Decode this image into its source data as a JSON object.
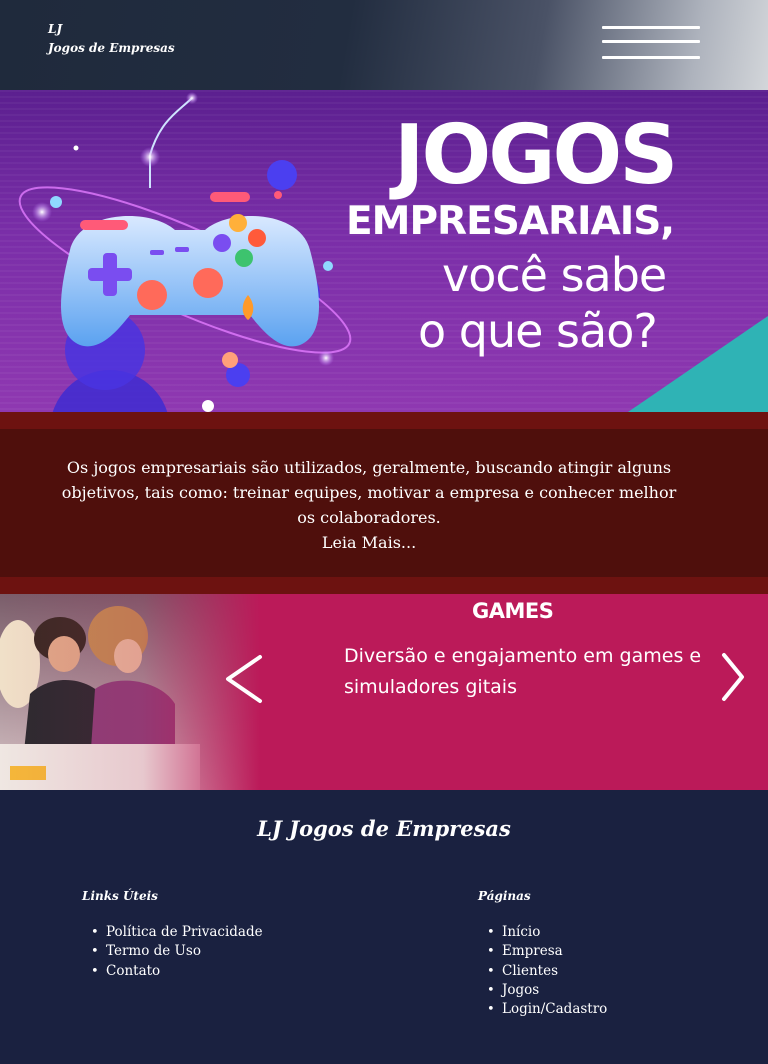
{
  "header": {
    "brand_line1": "LJ",
    "brand_line2": "Jogos de Empresas",
    "menu_icon": "hamburger-menu-icon"
  },
  "hero": {
    "line1": "JOGOS",
    "line2": "EMPRESARIAIS,",
    "line3": "você sabe",
    "line4": "o que são?",
    "illustration": "gamepad-icon"
  },
  "info": {
    "text": "Os jogos empresariais são utilizados, geralmente, buscando atingir alguns objetivos,  tais como: treinar equipes, motivar a empresa e conhecer melhor os colaboradores.",
    "read_more": "Leia Mais..."
  },
  "carousel": {
    "title": "GAMES",
    "text": "Diversão e engajamento em games e simuladores gitais",
    "prev_icon": "chevron-left-icon",
    "next_icon": "chevron-right-icon"
  },
  "footer": {
    "title": "LJ Jogos de Empresas",
    "links_heading": "Links Úteis",
    "links": [
      "Política de Privacidade",
      "Termo de Uso",
      "Contato"
    ],
    "pages_heading": "Páginas",
    "pages": [
      "Início",
      "Empresa",
      "Clientes",
      "Jogos",
      "Login/Cadastro"
    ]
  },
  "colors": {
    "header_dark": "#1f2a3c",
    "hero_purple": "#7a2ea8",
    "teal_accent": "#2fb3b5",
    "info_red": "#4f0f0c",
    "carousel_pink": "#bb1a59",
    "footer_navy": "#1a2140"
  }
}
